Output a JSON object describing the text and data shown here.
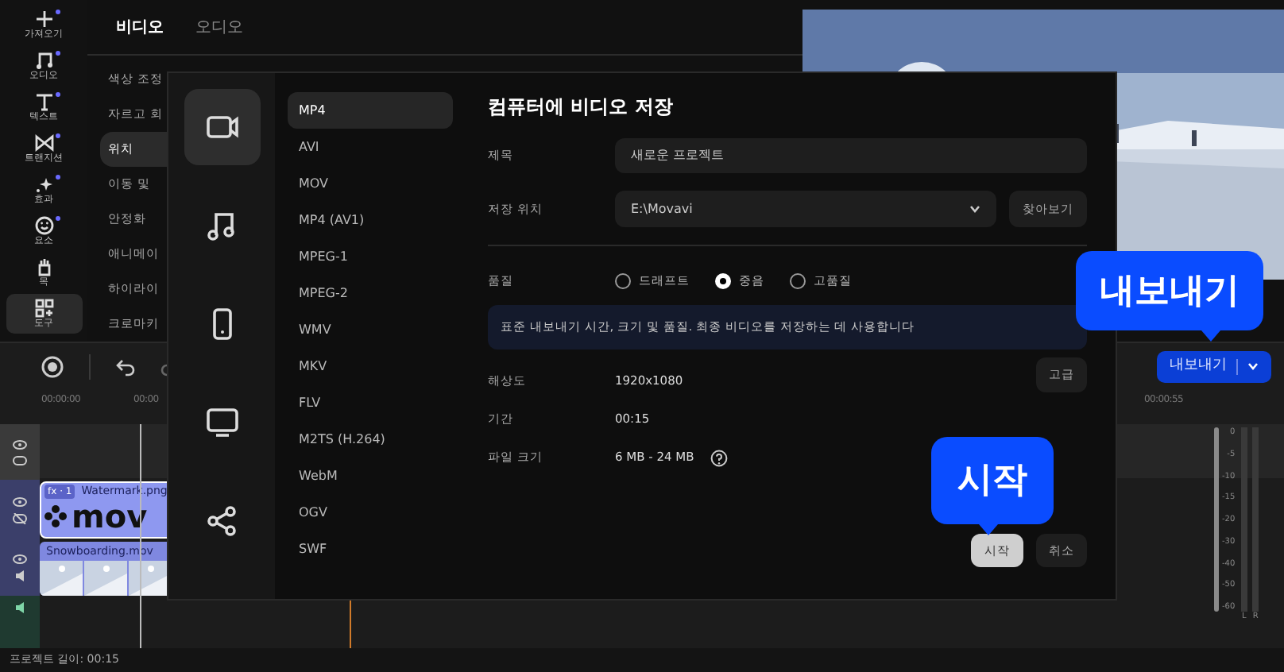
{
  "sidebar": {
    "items": [
      {
        "label": "가져오기",
        "selected": false,
        "new_dot": true
      },
      {
        "label": "오디오",
        "selected": false,
        "new_dot": true
      },
      {
        "label": "텍스트",
        "selected": false,
        "new_dot": true
      },
      {
        "label": "트랜지션",
        "selected": false,
        "new_dot": true
      },
      {
        "label": "효과",
        "selected": false,
        "new_dot": true
      },
      {
        "label": "요소",
        "selected": false,
        "new_dot": true
      },
      {
        "label": "목",
        "selected": false,
        "new_dot": false
      },
      {
        "label": "도구",
        "selected": true,
        "new_dot": false
      }
    ]
  },
  "tools_panel": {
    "tabs": [
      {
        "label": "비디오",
        "selected": true
      },
      {
        "label": "오디오",
        "selected": false
      }
    ],
    "items": [
      {
        "label": "색상 조정",
        "selected": false
      },
      {
        "label": "자르고 회",
        "selected": false
      },
      {
        "label": "위치",
        "selected": true
      },
      {
        "label": "이동 및",
        "selected": false
      },
      {
        "label": "안정화",
        "selected": false
      },
      {
        "label": "애니메이",
        "selected": false
      },
      {
        "label": "하이라이",
        "selected": false
      },
      {
        "label": "크로마키",
        "selected": false
      }
    ]
  },
  "timeline": {
    "ruler": [
      "00:00:00",
      "00:00",
      "00:00:55"
    ],
    "export_button": {
      "label": "내보내기"
    },
    "clips": [
      {
        "kind": "overlay",
        "badge": "fx · 1",
        "name": "Watermark.png",
        "logo_text": "mov"
      },
      {
        "kind": "video",
        "name": "Snowboarding.mov"
      }
    ],
    "meter": {
      "scale": [
        "0",
        "-5",
        "-10",
        "-15",
        "-20",
        "-30",
        "-40",
        "-50",
        "-60"
      ],
      "channels": [
        "L",
        "R"
      ]
    }
  },
  "status_bar": {
    "text": "프로젝트 길이: 00:15"
  },
  "dialog": {
    "categories": [
      {
        "selected": true
      },
      {
        "selected": false
      },
      {
        "selected": false
      },
      {
        "selected": false
      },
      {
        "selected": false
      }
    ],
    "formats": [
      {
        "label": "MP4",
        "selected": true
      },
      {
        "label": "AVI",
        "selected": false
      },
      {
        "label": "MOV",
        "selected": false
      },
      {
        "label": "MP4 (AV1)",
        "selected": false
      },
      {
        "label": "MPEG-1",
        "selected": false
      },
      {
        "label": "MPEG-2",
        "selected": false
      },
      {
        "label": "WMV",
        "selected": false
      },
      {
        "label": "MKV",
        "selected": false
      },
      {
        "label": "FLV",
        "selected": false
      },
      {
        "label": "M2TS (H.264)",
        "selected": false
      },
      {
        "label": "WebM",
        "selected": false
      },
      {
        "label": "OGV",
        "selected": false
      },
      {
        "label": "SWF",
        "selected": false
      }
    ],
    "title": "컴퓨터에 비디오 저장",
    "name_field": {
      "label": "제목",
      "value": "새로운 프로젝트"
    },
    "location_field": {
      "label": "저장 위치",
      "value": "E:\\Movavi",
      "browse": "찾아보기"
    },
    "quality": {
      "label": "품질",
      "options": [
        {
          "label": "드래프트",
          "selected": false
        },
        {
          "label": "중음",
          "selected": true
        },
        {
          "label": "고품질",
          "selected": false
        }
      ]
    },
    "info": "표준 내보내기 시간, 크기 및 품질. 최종 비디오를 저장하는 데 사용합니다",
    "details": [
      {
        "label": "해상도",
        "value": "1920x1080"
      },
      {
        "label": "기간",
        "value": "00:15"
      },
      {
        "label": "파일 크기",
        "value": "6 MB - 24 MB",
        "help": true
      }
    ],
    "advanced_button": "고급",
    "start_button": "시작",
    "cancel_button": "취소"
  },
  "callouts": [
    {
      "text": "내보내기"
    },
    {
      "text": "시작"
    }
  ]
}
